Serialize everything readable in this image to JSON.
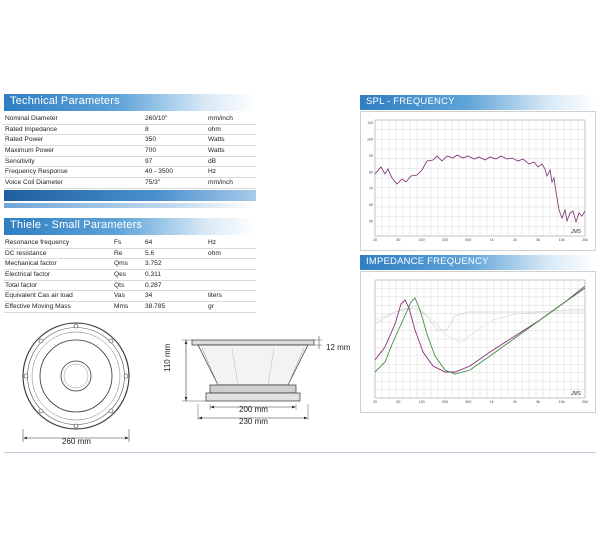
{
  "technical": {
    "title": "Technical Parameters",
    "rows": [
      [
        "Nominal Diameter",
        "260/10\"",
        "mm/inch"
      ],
      [
        "Rated Impedance",
        "8",
        "ohm"
      ],
      [
        "Rated Power",
        "350",
        "Watts"
      ],
      [
        "Maximum Power",
        "700",
        "Watts"
      ],
      [
        "Sensitivity",
        "97",
        "dB"
      ],
      [
        "Frequency Response",
        "40 - 3500",
        "Hz"
      ],
      [
        "Voice Coil Diameter",
        "75/3\"",
        "mm/inch"
      ]
    ]
  },
  "thiele": {
    "title": "Thiele - Small Parameters",
    "rows": [
      [
        "Resonance frequency",
        "Fs",
        "64",
        "Hz"
      ],
      [
        "DC resistance",
        "Re",
        "5.6",
        "ohm"
      ],
      [
        "Mechanical factor",
        "Qms",
        "3.752",
        ""
      ],
      [
        "Electrical factor",
        "Qes",
        "0.311",
        ""
      ],
      [
        "Total factor",
        "Qts",
        "0.287",
        ""
      ],
      [
        "Equivalent Cas air load",
        "Vas",
        "34",
        "liters"
      ],
      [
        "Effective Moving Mass",
        "Mms",
        "38.785",
        "gr"
      ]
    ]
  },
  "spl": {
    "title": "SPL - FREQUENCY",
    "logo": "JMS",
    "x_ticks": [
      "20",
      "50",
      "100",
      "200",
      "500",
      "1k",
      "2k",
      "5k",
      "10k",
      "20k"
    ],
    "y_ticks": [
      "110",
      "100",
      "90",
      "80",
      "70",
      "60",
      "50"
    ]
  },
  "impedance": {
    "title": "IMPEDANCE FREQUENCY",
    "logo": "JMS",
    "x_ticks": [
      "20",
      "50",
      "100",
      "200",
      "500",
      "1k",
      "2k",
      "5k",
      "10k",
      "20k"
    ]
  },
  "dimensions": {
    "front_width": "260 mm",
    "depth": "110 mm",
    "flange": "12 mm",
    "magnet_width": "200 mm",
    "outer_width": "230 mm"
  },
  "colors": {
    "band": "#2f7ec2",
    "spl_curve": "#7a2d6e",
    "imp_purple": "#8a2e7e",
    "imp_green": "#3f8f3f",
    "grid": "#c9c9c9"
  }
}
